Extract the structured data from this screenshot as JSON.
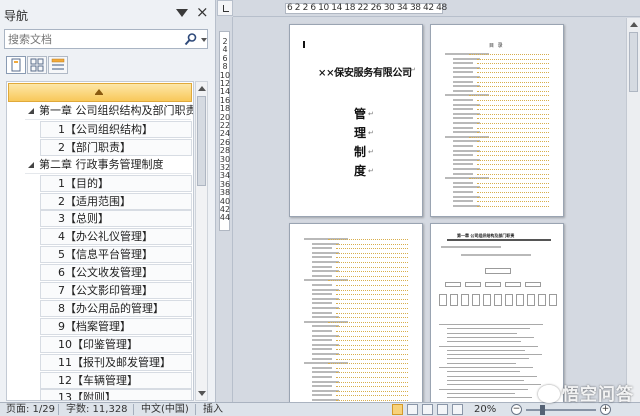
{
  "nav": {
    "title": "导航",
    "close_glyph": "×",
    "search_placeholder": "搜索文档",
    "tabs": [
      "headings-tab",
      "pages-tab",
      "results-tab"
    ],
    "tree": [
      {
        "level": 1,
        "label": "第一章  公司组织结构及部门职责"
      },
      {
        "level": 2,
        "label": "1【公司组织结构】"
      },
      {
        "level": 2,
        "label": "2【部门职责】"
      },
      {
        "level": 1,
        "label": "第二章  行政事务管理制度"
      },
      {
        "level": 2,
        "label": "1【目的】"
      },
      {
        "level": 2,
        "label": "2【适用范围】"
      },
      {
        "level": 2,
        "label": "3【总则】"
      },
      {
        "level": 2,
        "label": "4【办公礼仪管理】"
      },
      {
        "level": 2,
        "label": "5【信息平台管理】"
      },
      {
        "level": 2,
        "label": "6【公文收发管理】"
      },
      {
        "level": 2,
        "label": "7【公文影印管理】"
      },
      {
        "level": 2,
        "label": "8【办公用品的管理】"
      },
      {
        "level": 2,
        "label": "9【档案管理】"
      },
      {
        "level": 2,
        "label": "10【印鉴管理】"
      },
      {
        "level": 2,
        "label": "11【报刊及邮发管理】"
      },
      {
        "level": 2,
        "label": "12【车辆管理】"
      },
      {
        "level": 2,
        "label": "13【附则】"
      }
    ]
  },
  "ruler": {
    "horizontal": "6 2 2 6 10 14 18 22 26 30 34 38 42 48",
    "vertical": [
      "2",
      "4",
      "6",
      "8",
      "10",
      "12",
      "14",
      "16",
      "18",
      "20",
      "22",
      "24",
      "26",
      "28",
      "30",
      "32",
      "34",
      "36",
      "38",
      "40",
      "42",
      "44"
    ]
  },
  "document": {
    "company": "××保安服务有限公司",
    "title_chars": [
      "管",
      "理",
      "制",
      "度"
    ],
    "paragraph_mark": "↵",
    "page2_heading": "目  录",
    "page4_heading": "第一章  公司组织结构及部门职责"
  },
  "status": {
    "page": "页面: 1/29",
    "words": "字数: 11,328",
    "language": "中文(中国)",
    "mode": "插入",
    "zoom": "20%",
    "zoom_minus": "−",
    "zoom_plus": "+"
  },
  "watermark": "悟空问答",
  "colors": {
    "selection": "#f8c85a",
    "toc_dots": "#d8ae4c"
  }
}
